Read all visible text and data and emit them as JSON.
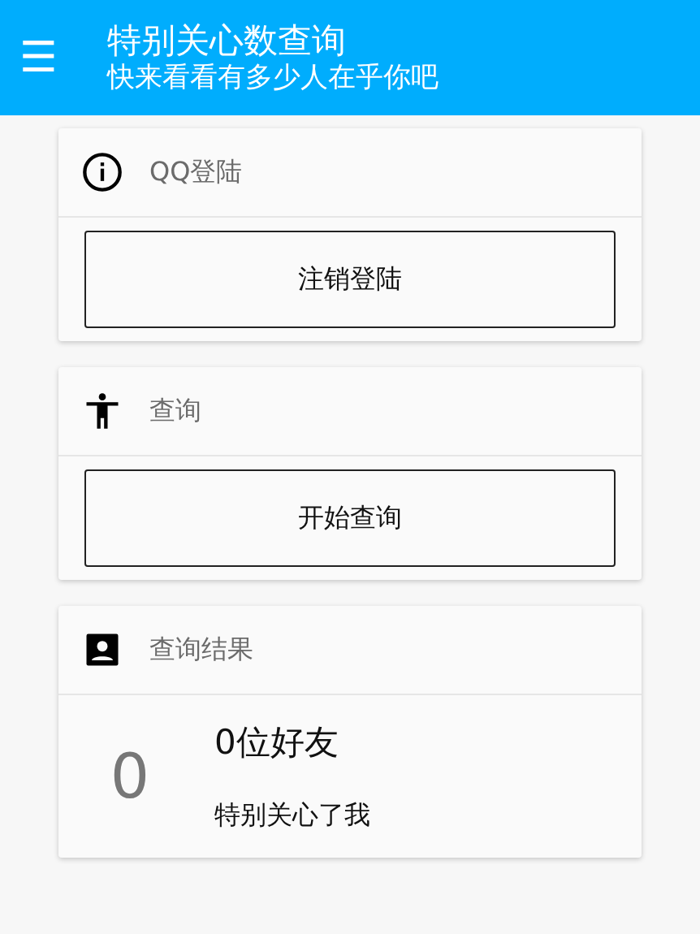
{
  "app_bar": {
    "menu_icon": "☰",
    "title": "特别关心数查询",
    "subtitle": "快来看看有多少人在乎你吧"
  },
  "cards": [
    {
      "title": "QQ登陆",
      "kind": "button",
      "button": "注销登陆"
    },
    {
      "title": "查询",
      "kind": "button",
      "button": "开始查询"
    },
    {
      "title": "查询结果",
      "kind": "result",
      "count": "0",
      "headline": "0位好友",
      "caption": "特别关心了我"
    }
  ]
}
